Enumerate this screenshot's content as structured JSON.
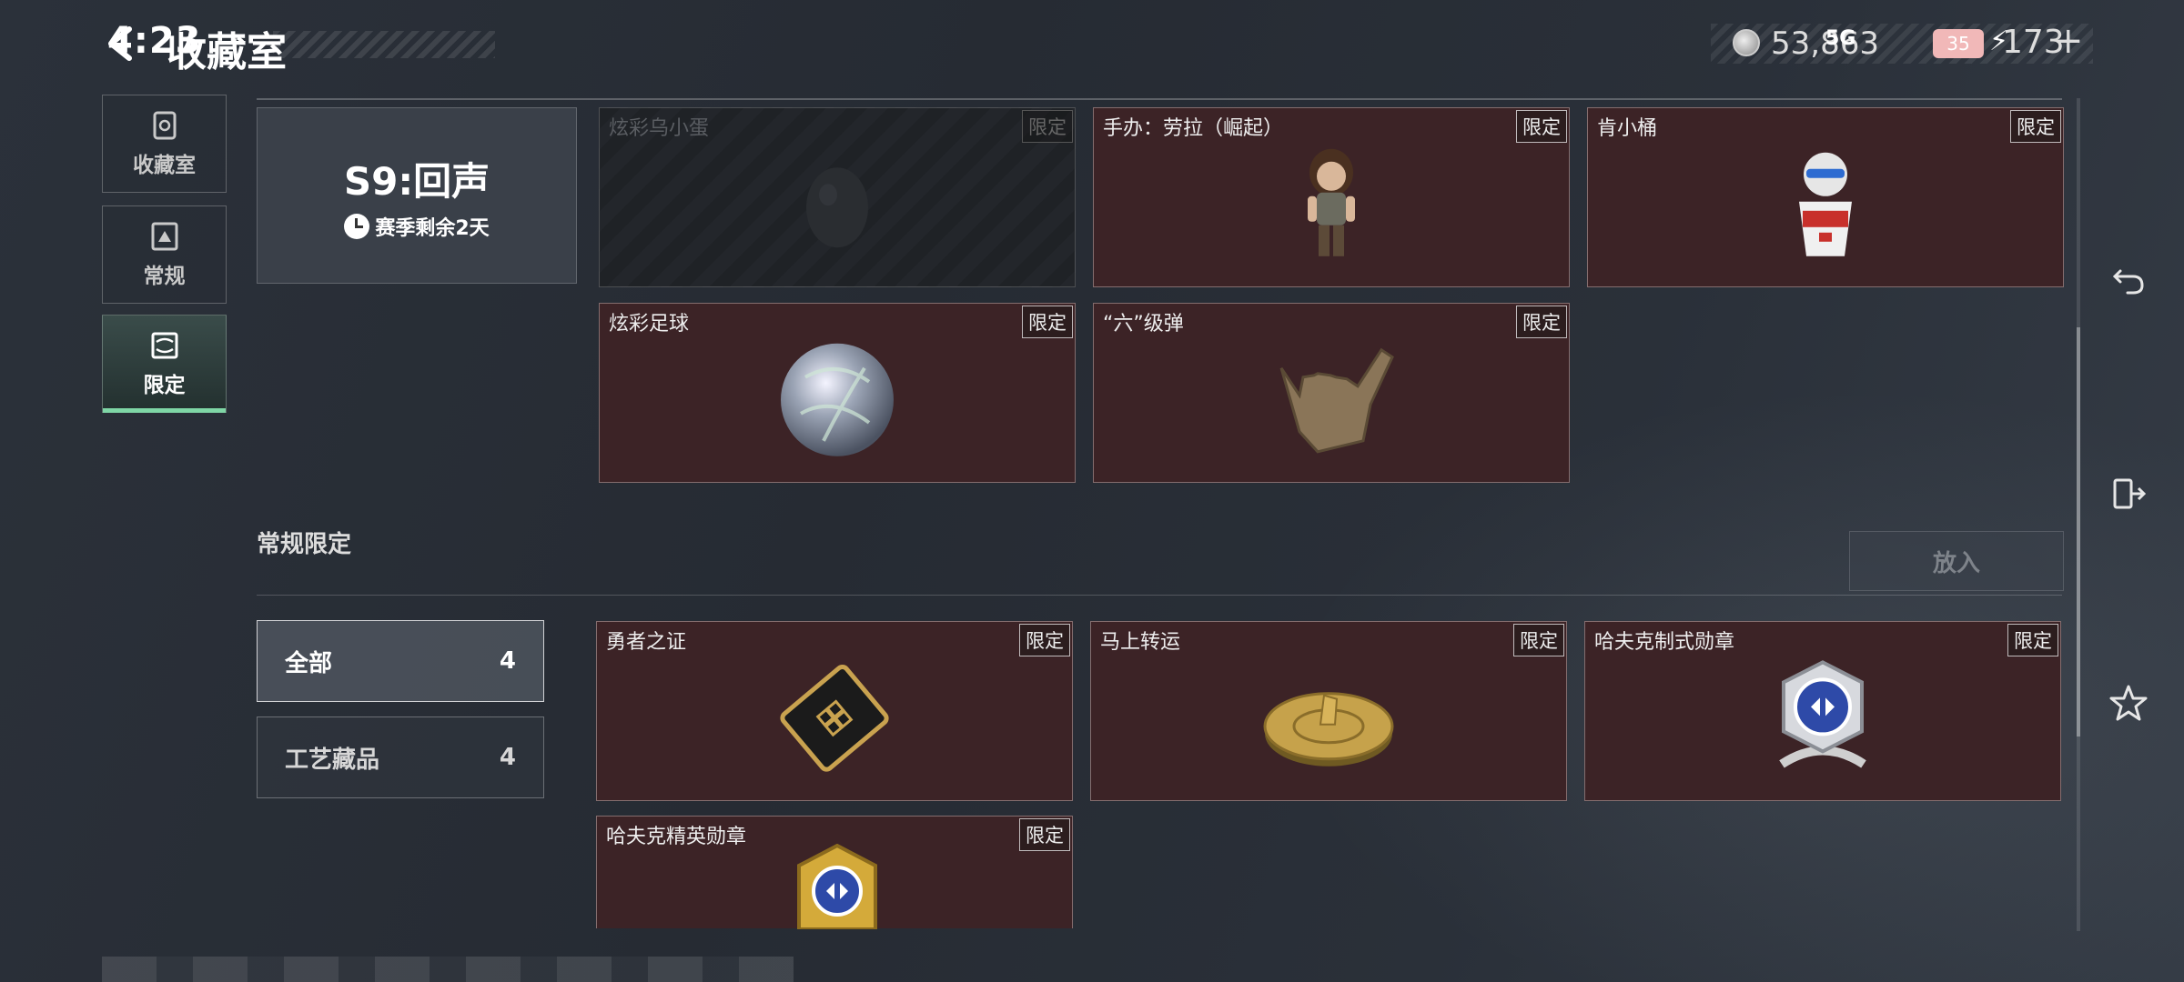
{
  "header": {
    "time": "4:23",
    "title": "收藏室",
    "currency": "53,863",
    "signal": "5G",
    "battery": "35",
    "tickets": "173",
    "plus": "+"
  },
  "nav": {
    "items": [
      {
        "label": "收藏室",
        "icon": "collection-icon"
      },
      {
        "label": "常规",
        "icon": "regular-icon"
      },
      {
        "label": "限定",
        "icon": "limited-icon",
        "active": true
      }
    ]
  },
  "season": {
    "name": "S9:回声",
    "remaining": "赛季剩余2天"
  },
  "limited_items": [
    {
      "name": "炫彩乌小蛋",
      "badge": "限定",
      "locked": true
    },
    {
      "name": "手办：劳拉（崛起）",
      "badge": "限定"
    },
    {
      "name": "肯小桶",
      "badge": "限定"
    },
    {
      "name": "炫彩足球",
      "badge": "限定"
    },
    {
      "name": "“六”级弹",
      "badge": "限定"
    }
  ],
  "regular_section": {
    "title": "常规限定",
    "put_button": "放入"
  },
  "filters": [
    {
      "label": "全部",
      "count": "4",
      "active": true
    },
    {
      "label": "工艺藏品",
      "count": "4"
    }
  ],
  "regular_items": [
    {
      "name": "勇者之证",
      "badge": "限定"
    },
    {
      "name": "马上转运",
      "badge": "限定"
    },
    {
      "name": "哈夫克制式勋章",
      "badge": "限定"
    },
    {
      "name": "哈夫克精英勋章",
      "badge": "限定"
    }
  ],
  "colors": {
    "card_bg": "#3c2326",
    "accent": "#7fd6a6"
  }
}
